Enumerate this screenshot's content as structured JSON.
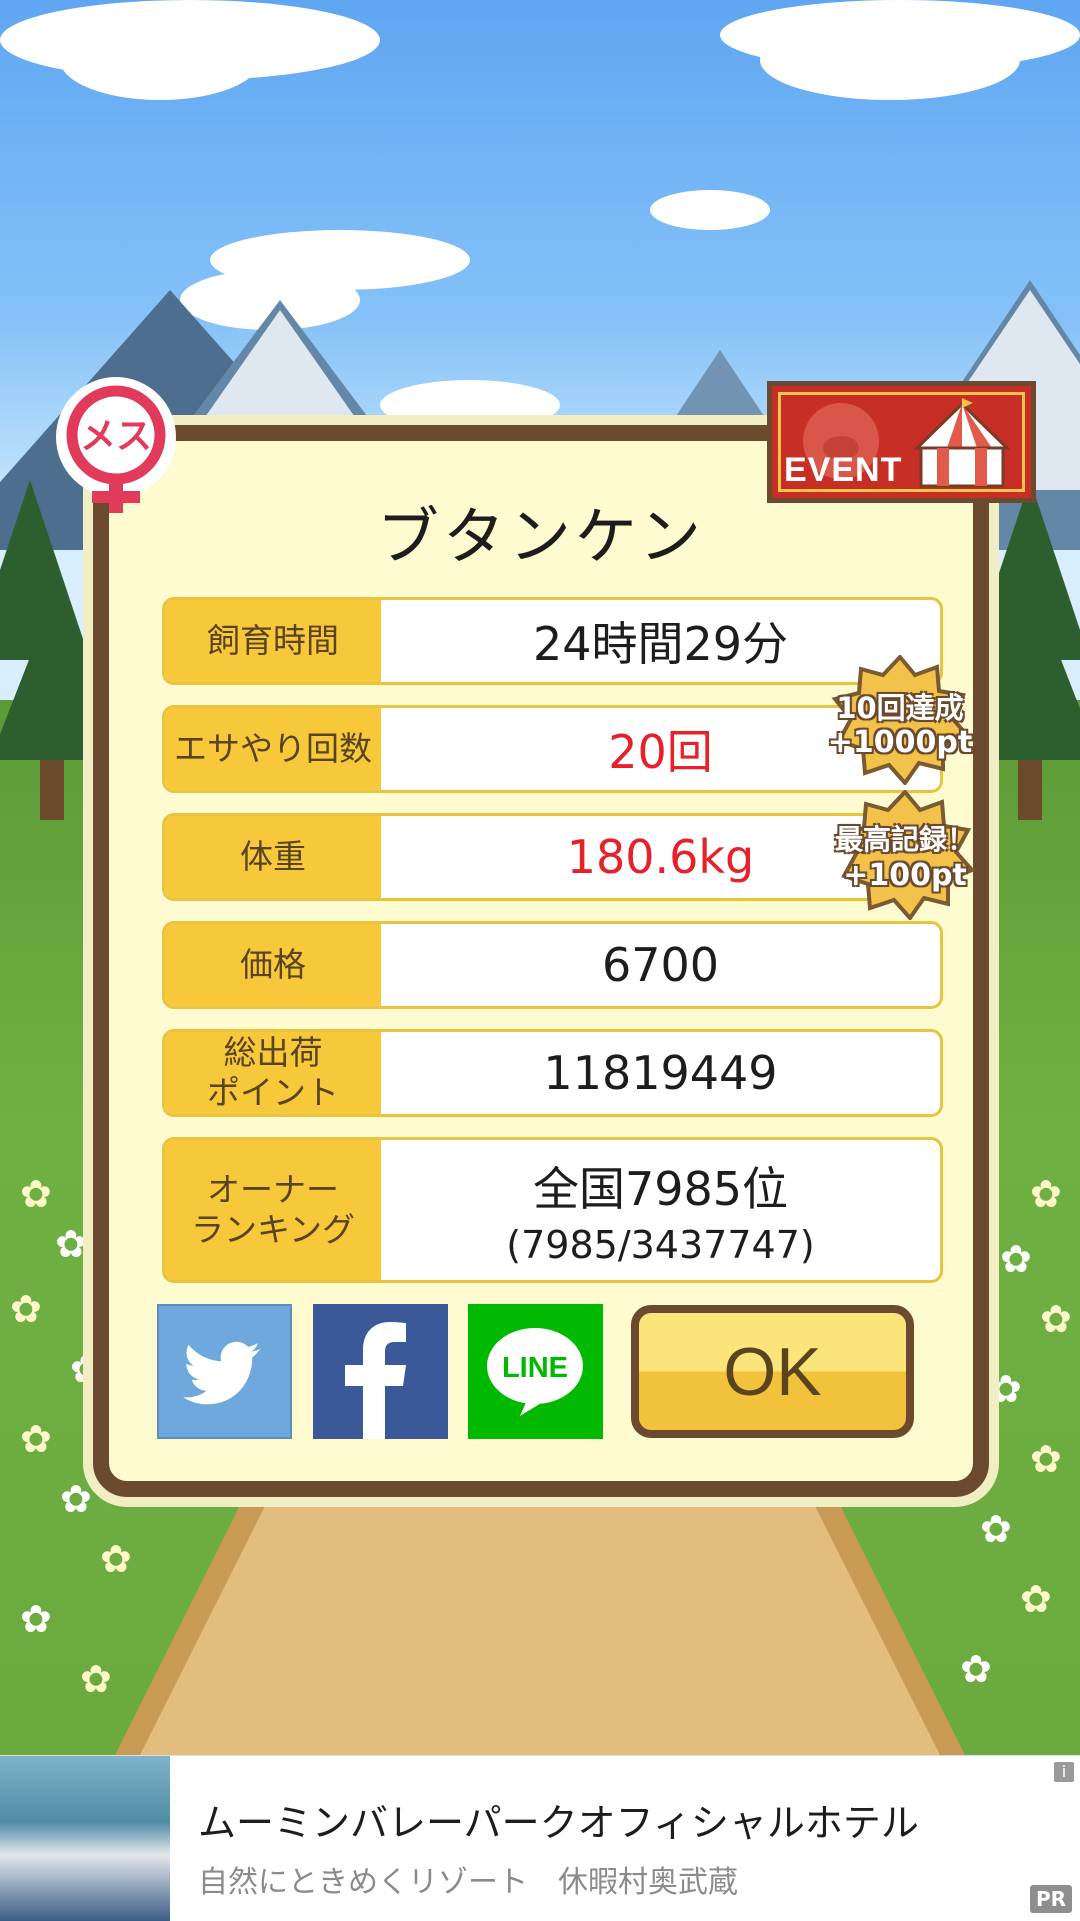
{
  "pig": {
    "name": "ブタンケン",
    "gender_badge": "メス"
  },
  "event_badge": "EVENT",
  "stats": [
    {
      "label": "飼育時間",
      "value": "24時間29分",
      "highlight": false
    },
    {
      "label": "エサやり回数",
      "value": "20回",
      "highlight": true
    },
    {
      "label": "体重",
      "value": "180.6kg",
      "highlight": true
    },
    {
      "label": "価格",
      "value": "6700",
      "highlight": false
    },
    {
      "label": "総出荷\nポイント",
      "value": "11819449",
      "highlight": false
    },
    {
      "label": "オーナー\nランキング",
      "value": "全国7985位",
      "sub": "(7985/3437747)",
      "highlight": false
    }
  ],
  "bonus_stamps": [
    {
      "line1": "10回達成",
      "line2": "+1000pt"
    },
    {
      "line1": "最高記録！",
      "line2": "+100pt"
    }
  ],
  "share": {
    "twitter_icon": "twitter-icon",
    "facebook_icon": "facebook-icon",
    "line_icon": "line-icon",
    "line_text": "LINE"
  },
  "ok_label": "OK",
  "ad": {
    "headline": "ムーミンバレーパークオフィシャルホテル",
    "subtext": "自然にときめくリゾート　休暇村奥武蔵",
    "pr_label": "PR",
    "info_label": "i"
  },
  "colors": {
    "highlight": "#e8202a",
    "label_bg": "#f7c93a",
    "frame": "#6b4a2f",
    "twitter": "#6fa8dc",
    "facebook": "#3b5998",
    "line": "#00b900"
  }
}
